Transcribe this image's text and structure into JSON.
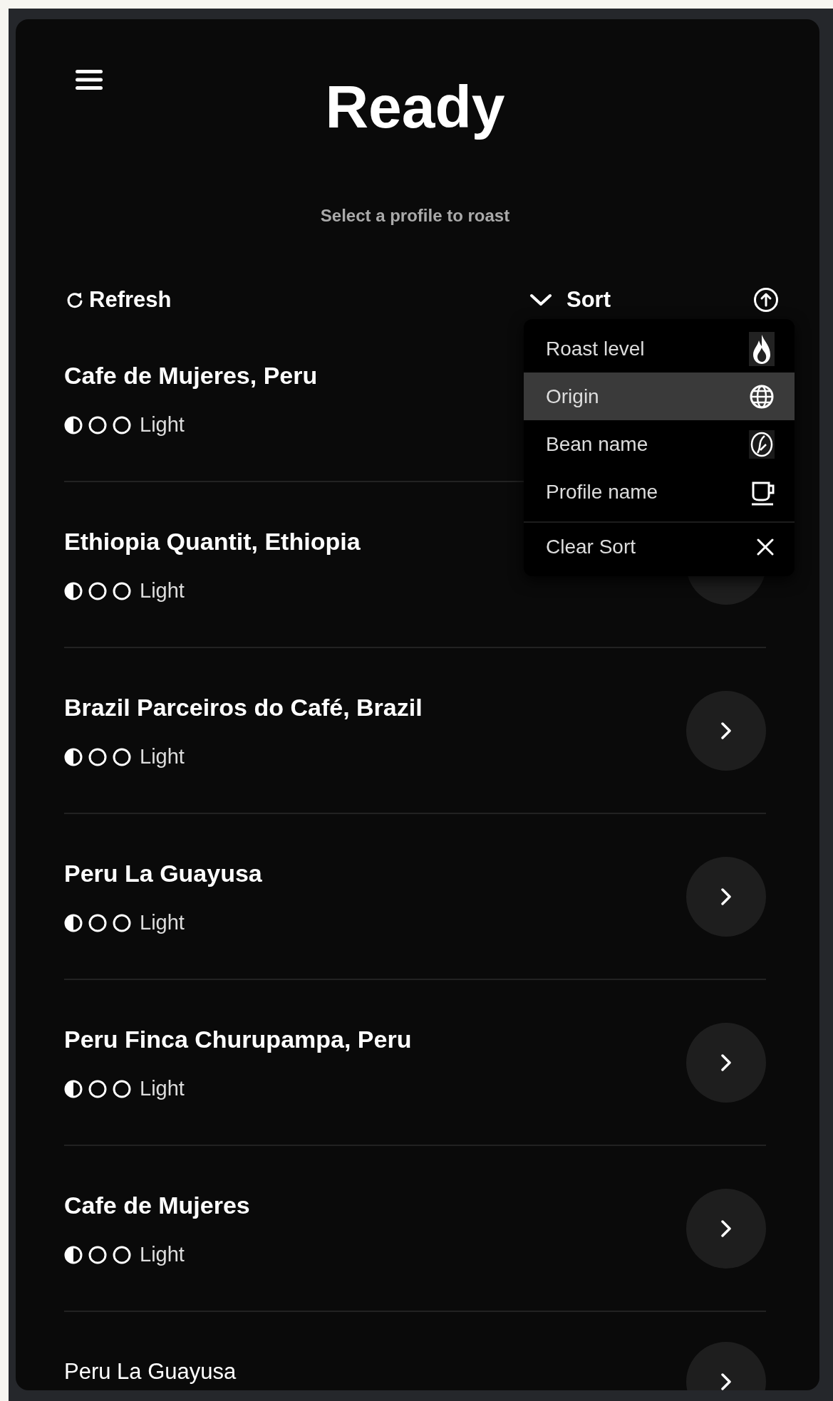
{
  "header": {
    "title": "Ready",
    "subtitle": "Select a profile to roast"
  },
  "toolbar": {
    "refresh": "Refresh",
    "sort": "Sort"
  },
  "sort_menu": {
    "expanded": true,
    "clear": "Clear Sort",
    "options": [
      {
        "label": "Roast level",
        "kind": "flame",
        "selected": false
      },
      {
        "label": "Origin",
        "kind": "globe",
        "selected": true
      },
      {
        "label": "Bean name",
        "kind": "bean",
        "selected": false
      },
      {
        "label": "Profile name",
        "kind": "cup",
        "selected": false
      }
    ]
  },
  "profiles": [
    {
      "kind": "full",
      "name": "Cafe de Mujeres, Peru",
      "stars": 0.5,
      "roast": "Light"
    },
    {
      "kind": "full",
      "name": "Ethiopia Quantit, Ethiopia",
      "stars": 0.5,
      "roast": "Light"
    },
    {
      "kind": "full",
      "name": "Brazil Parceiros do Café, Brazil",
      "stars": 0.5,
      "roast": "Light"
    },
    {
      "kind": "full",
      "name": "Peru La Guayusa",
      "stars": 0.5,
      "roast": "Light"
    },
    {
      "kind": "full",
      "name": "Peru Finca Churupampa, Peru",
      "stars": 0.5,
      "roast": "Light"
    },
    {
      "kind": "full",
      "name": "Cafe de Mujeres",
      "stars": 0.5,
      "roast": "Light"
    },
    {
      "kind": "compact",
      "name": "Peru La Guayusa"
    }
  ]
}
